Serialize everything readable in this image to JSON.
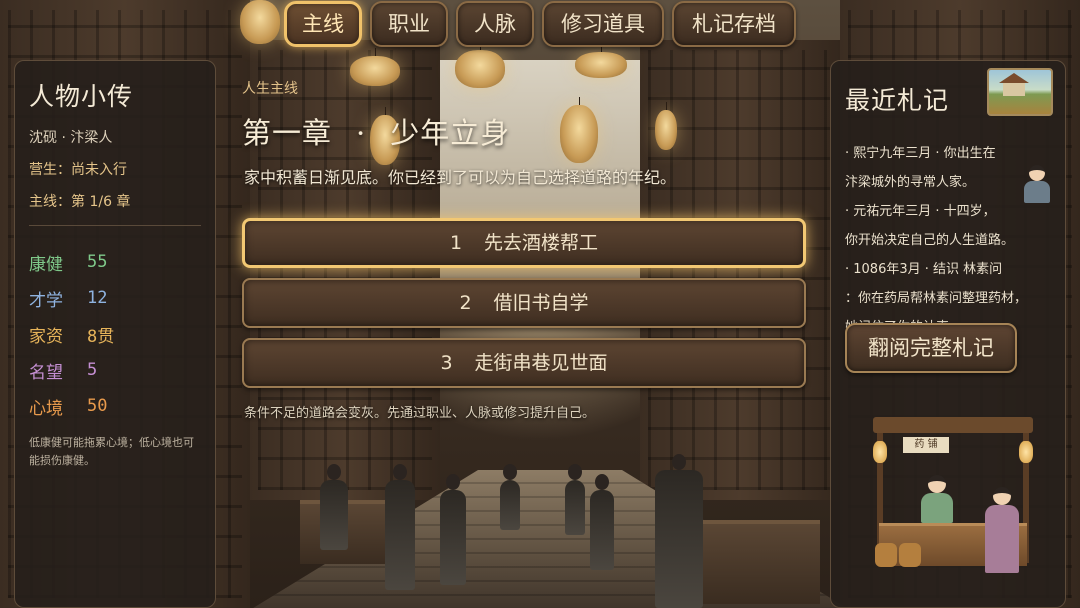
{
  "tabs": [
    {
      "label": "主线",
      "active": true
    },
    {
      "label": "职业",
      "active": false
    },
    {
      "label": "人脉",
      "active": false
    },
    {
      "label": "修习道具",
      "active": false
    },
    {
      "label": "札记存档",
      "active": false
    }
  ],
  "bio": {
    "title": "人物小传",
    "identity": "沈砚 · 汴梁人",
    "livelihood": "营生：尚未入行",
    "mainline": "主线：第 1/6 章",
    "stats": [
      {
        "label": "康健",
        "value": "55",
        "color": "#7fc98a"
      },
      {
        "label": "才学",
        "value": "12",
        "color": "#8fb3e0"
      },
      {
        "label": "家资",
        "value": "8贯",
        "color": "#e7b45a"
      },
      {
        "label": "名望",
        "value": "5",
        "color": "#c58fd3"
      },
      {
        "label": "心境",
        "value": "50",
        "color": "#e89a4c"
      }
    ],
    "note": "低康健可能拖累心境；低心境也可能损伤康健。"
  },
  "story": {
    "section_label": "人生主线",
    "chapter_number": "第一章",
    "chapter_sep": "·",
    "chapter_name": "少年立身",
    "text": "家中积蓄日渐见底。你已经到了可以为自己选择道路的年纪。",
    "choices": [
      {
        "num": "1",
        "label": "先去酒楼帮工",
        "active": true
      },
      {
        "num": "2",
        "label": "借旧书自学",
        "active": false
      },
      {
        "num": "3",
        "label": "走街串巷见世面",
        "active": false
      }
    ],
    "hint": "条件不足的道路会变灰。先通过职业、人脉或修习提升自己。"
  },
  "notes": {
    "title": "最近札记",
    "items": [
      "· 熙宁九年三月 · 你出生在",
      "汴梁城外的寻常人家。",
      "· 元祐元年三月 · 十四岁，",
      "你开始决定自己的人生道路。",
      "· 1086年3月 · 结识 林素问",
      "：你在药局帮林素问整理药材，",
      "她记住了你的认真。"
    ],
    "button_label": "翻阅完整札记",
    "shop_sign": "药 铺"
  }
}
